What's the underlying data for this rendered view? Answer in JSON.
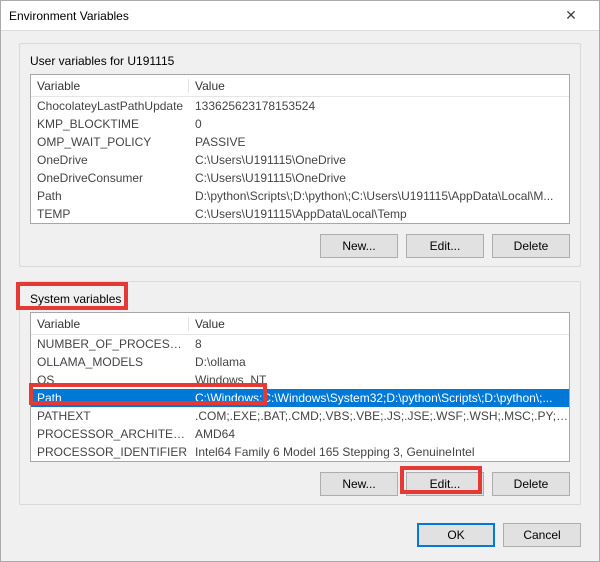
{
  "window": {
    "title": "Environment Variables",
    "close_glyph": "✕"
  },
  "user_section": {
    "label": "User variables for U191115",
    "header_variable": "Variable",
    "header_value": "Value",
    "rows": [
      {
        "name": "ChocolateyLastPathUpdate",
        "value": "133625623178153524"
      },
      {
        "name": "KMP_BLOCKTIME",
        "value": "0"
      },
      {
        "name": "OMP_WAIT_POLICY",
        "value": "PASSIVE"
      },
      {
        "name": "OneDrive",
        "value": "C:\\Users\\U191115\\OneDrive"
      },
      {
        "name": "OneDriveConsumer",
        "value": "C:\\Users\\U191115\\OneDrive"
      },
      {
        "name": "Path",
        "value": "D:\\python\\Scripts\\;D:\\python\\;C:\\Users\\U191115\\AppData\\Local\\M..."
      },
      {
        "name": "TEMP",
        "value": "C:\\Users\\U191115\\AppData\\Local\\Temp"
      }
    ],
    "buttons": {
      "new": "New...",
      "edit": "Edit...",
      "delete": "Delete"
    }
  },
  "system_section": {
    "label": "System variables",
    "header_variable": "Variable",
    "header_value": "Value",
    "rows": [
      {
        "name": "NUMBER_OF_PROCESSORS",
        "value": "8"
      },
      {
        "name": "OLLAMA_MODELS",
        "value": "D:\\ollama"
      },
      {
        "name": "OS",
        "value": "Windows_NT"
      },
      {
        "name": "Path",
        "value": "C:\\Windows;C:\\Windows\\System32;D:\\python\\Scripts\\;D:\\python\\;..."
      },
      {
        "name": "PATHEXT",
        "value": ".COM;.EXE;.BAT;.CMD;.VBS;.VBE;.JS;.JSE;.WSF;.WSH;.MSC;.PY;.PYW"
      },
      {
        "name": "PROCESSOR_ARCHITECTURE",
        "value": "AMD64"
      },
      {
        "name": "PROCESSOR_IDENTIFIER",
        "value": "Intel64 Family 6 Model 165 Stepping 3, GenuineIntel"
      }
    ],
    "selected_index": 3,
    "buttons": {
      "new": "New...",
      "edit": "Edit...",
      "delete": "Delete"
    }
  },
  "footer": {
    "ok": "OK",
    "cancel": "Cancel"
  },
  "highlights": {
    "system_label": true,
    "path_row": true,
    "edit_button": true
  }
}
